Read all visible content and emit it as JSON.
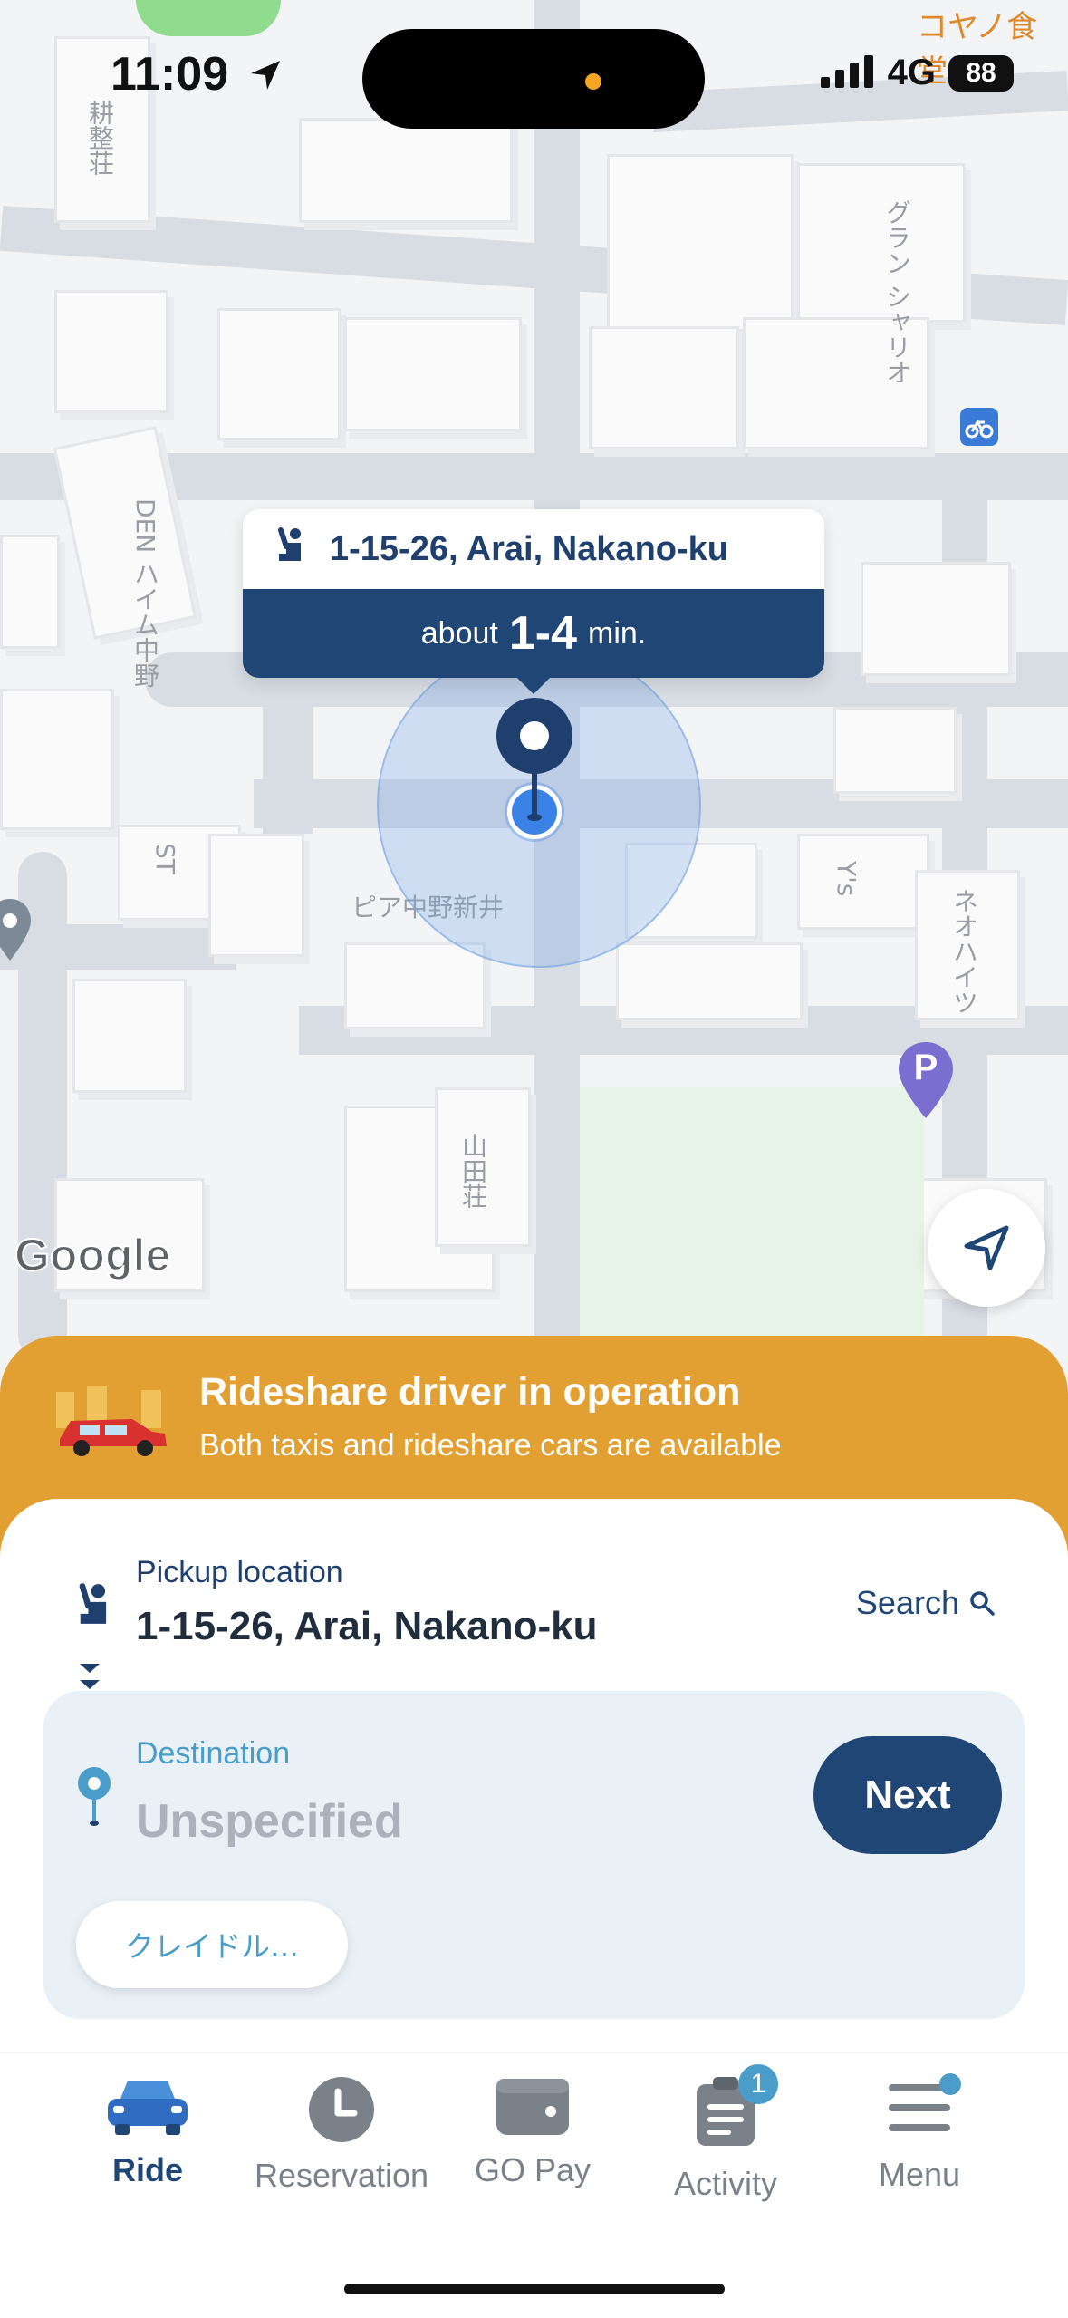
{
  "status_bar": {
    "time": "11:09",
    "network": "4G",
    "battery": "88"
  },
  "map": {
    "labels": [
      {
        "text": "耕整荘",
        "vertical": true
      },
      {
        "text": "グラン シャリオ",
        "vertical": true
      },
      {
        "text": "DEN ハイム中野",
        "vertical": true
      },
      {
        "text": "ST",
        "vertical": true
      },
      {
        "text": "ピア中野新井",
        "vertical": false
      },
      {
        "text": "Y's",
        "vertical": true
      },
      {
        "text": "ネオハイツ",
        "vertical": true
      },
      {
        "text": "山田荘",
        "vertical": true
      },
      {
        "text": "コヤノ食堂",
        "vertical": false
      }
    ],
    "google_logo": "Google",
    "parking_label": "P"
  },
  "callout": {
    "address": "1-15-26, Arai, Nakano-ku",
    "eta_prefix": "about",
    "eta_value": "1-4",
    "eta_suffix": "min."
  },
  "banner": {
    "title": "Rideshare driver in operation",
    "subtitle": "Both taxis and rideshare cars are available"
  },
  "pickup": {
    "label": "Pickup location",
    "value": "1-15-26, Arai, Nakano-ku",
    "search_label": "Search"
  },
  "destination": {
    "label": "Destination",
    "value": "Unspecified",
    "next_label": "Next",
    "chip_label": "クレイドル…"
  },
  "tabs": [
    {
      "label": "Ride",
      "active": true,
      "icon": "car-icon"
    },
    {
      "label": "Reservation",
      "active": false,
      "icon": "clock-icon"
    },
    {
      "label": "GO Pay",
      "active": false,
      "icon": "wallet-icon"
    },
    {
      "label": "Activity",
      "active": false,
      "icon": "clipboard-icon",
      "badge": "1"
    },
    {
      "label": "Menu",
      "active": false,
      "icon": "hamburger-icon"
    }
  ],
  "colors": {
    "brand_navy": "#1f4675",
    "banner_orange": "#e3a032",
    "destination_blue": "#4a9cc9"
  }
}
